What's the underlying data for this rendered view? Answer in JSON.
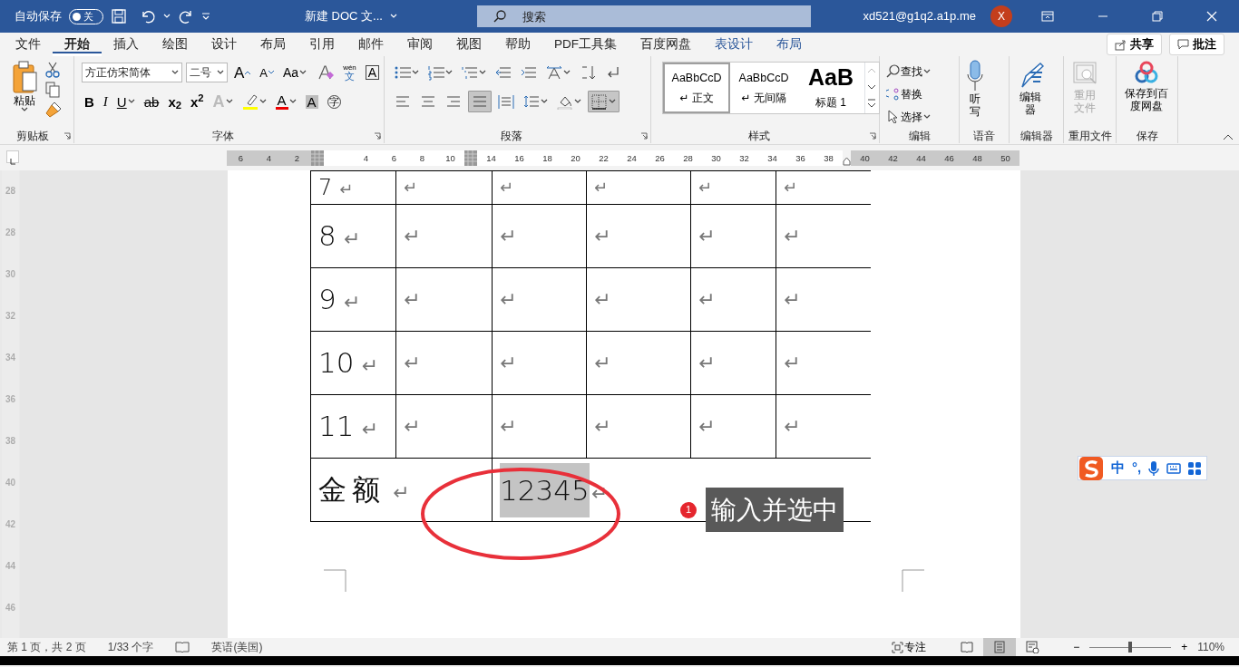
{
  "title_bar": {
    "autosave_label": "自动保存",
    "autosave": {
      "on": false,
      "label": "关"
    },
    "document_title": "新建 DOC 文...",
    "search": {
      "placeholder": "搜索"
    },
    "account": "xd521@g1q2.a1p.me",
    "avatar_initial": "X"
  },
  "ribbon_tabs": [
    {
      "label": "文件",
      "selected": false,
      "kind": "normal"
    },
    {
      "label": "开始",
      "selected": true,
      "kind": "normal"
    },
    {
      "label": "插入",
      "selected": false,
      "kind": "normal"
    },
    {
      "label": "绘图",
      "selected": false,
      "kind": "normal"
    },
    {
      "label": "设计",
      "selected": false,
      "kind": "normal"
    },
    {
      "label": "布局",
      "selected": false,
      "kind": "normal"
    },
    {
      "label": "引用",
      "selected": false,
      "kind": "normal"
    },
    {
      "label": "邮件",
      "selected": false,
      "kind": "normal"
    },
    {
      "label": "审阅",
      "selected": false,
      "kind": "normal"
    },
    {
      "label": "视图",
      "selected": false,
      "kind": "normal"
    },
    {
      "label": "帮助",
      "selected": false,
      "kind": "normal"
    },
    {
      "label": "PDF工具集",
      "selected": false,
      "kind": "normal"
    },
    {
      "label": "百度网盘",
      "selected": false,
      "kind": "normal"
    },
    {
      "label": "表设计",
      "selected": false,
      "kind": "contextual"
    },
    {
      "label": "布局",
      "selected": false,
      "kind": "contextual"
    }
  ],
  "share_button": "共享",
  "comments_button": "批注",
  "ribbon": {
    "clipboard": {
      "paste": "粘贴",
      "label": "剪贴板"
    },
    "font": {
      "font_name": "方正仿宋简体",
      "font_size": "二号",
      "label": "字体",
      "row1": [
        {
          "kind": "grow",
          "text": "A"
        },
        {
          "kind": "shrink",
          "text": "A"
        },
        {
          "kind": "case",
          "text": "Aa"
        },
        {
          "kind": "clear"
        },
        {
          "kind": "phonetic",
          "text": "wén",
          "sub": "文"
        },
        {
          "kind": "border",
          "text": "A"
        }
      ],
      "row2": [
        {
          "kind": "bold",
          "text": "B"
        },
        {
          "kind": "italic",
          "text": "I"
        },
        {
          "kind": "underline",
          "text": "U"
        },
        {
          "kind": "strike",
          "text": "ab"
        },
        {
          "kind": "subscript",
          "text": "x$_{2}$"
        },
        {
          "kind": "superscript",
          "text": "x$^{2}$"
        },
        {
          "kind": "effects",
          "text": "A"
        },
        {
          "kind": "highlight"
        },
        {
          "kind": "color",
          "text": "A"
        },
        {
          "kind": "shading",
          "text": "A"
        },
        {
          "kind": "enclose",
          "text": "字"
        }
      ]
    },
    "paragraph": {
      "label": "段落",
      "row1": [
        {
          "kind": "bullets"
        },
        {
          "kind": "numbering"
        },
        {
          "kind": "multilevel"
        },
        {
          "kind": "outdent"
        },
        {
          "kind": "indent"
        },
        {
          "kind": "asian-layout"
        },
        {
          "kind": "sort"
        },
        {
          "kind": "marks"
        }
      ],
      "row2": [
        {
          "kind": "align-left",
          "selected": false
        },
        {
          "kind": "align-center",
          "selected": false
        },
        {
          "kind": "align-right",
          "selected": false
        },
        {
          "kind": "justify",
          "selected": true
        },
        {
          "kind": "distribute",
          "selected": false
        },
        {
          "kind": "line-spacing",
          "selected": false
        },
        {
          "kind": "fill",
          "selected": false
        },
        {
          "kind": "borders",
          "selected": true
        }
      ]
    },
    "styles": {
      "label": "样式",
      "items": [
        {
          "preview": "AaBbCcD",
          "name": "↵ 正文",
          "selected": true,
          "kind": "body"
        },
        {
          "preview": "AaBbCcD",
          "name": "↵ 无间隔",
          "selected": false,
          "kind": "body"
        },
        {
          "preview": "AaB",
          "name": "标题 1",
          "selected": false,
          "kind": "heading"
        }
      ]
    },
    "editing": {
      "label": "编辑",
      "find": "查找",
      "replace": "替换",
      "select": "选择"
    },
    "voice": {
      "label": "语音",
      "dictate": "听写"
    },
    "editor": {
      "label": "编辑器",
      "button": "编辑器"
    },
    "reuse": {
      "label": "重用文件",
      "button": "重用文件",
      "disabled": true
    },
    "save": {
      "label": "保存",
      "button": "保存到百度网盘"
    }
  },
  "ruler": {
    "segments": [
      {
        "shaded": true,
        "ticks": [
          "6",
          "4",
          "2"
        ]
      },
      {
        "shaded": false,
        "ticks": [
          "4",
          "6",
          "8",
          "10"
        ]
      },
      {
        "shaded": false,
        "ticks": [
          "14",
          "16",
          "18",
          "20",
          "22",
          "24",
          "26",
          "28",
          "30",
          "32",
          "34",
          "36",
          "38"
        ]
      },
      {
        "shaded": true,
        "ticks": [
          "40",
          "42",
          "44",
          "46",
          "48",
          "50"
        ]
      }
    ]
  },
  "vertical_ruler": [
    "28",
    "28",
    "30",
    "32",
    "34",
    "36",
    "38",
    "40",
    "42",
    "44",
    "46"
  ],
  "table": {
    "rows": [
      {
        "cells": [
          {
            "text": "7",
            "mark": "↵"
          },
          {
            "mark": "↵"
          },
          {
            "mark": "↵"
          },
          {
            "mark": "↵"
          },
          {
            "mark": "↵"
          },
          {
            "mark": "↵"
          }
        ]
      },
      {
        "cells": [
          {
            "text": "8",
            "mark": "↵"
          },
          {
            "mark": "↵"
          },
          {
            "mark": "↵"
          },
          {
            "mark": "↵"
          },
          {
            "mark": "↵"
          },
          {
            "mark": "↵"
          }
        ]
      },
      {
        "cells": [
          {
            "text": "9",
            "mark": "↵"
          },
          {
            "mark": "↵"
          },
          {
            "mark": "↵"
          },
          {
            "mark": "↵"
          },
          {
            "mark": "↵"
          },
          {
            "mark": "↵"
          }
        ]
      },
      {
        "cells": [
          {
            "text": "10",
            "mark": "↵"
          },
          {
            "mark": "↵"
          },
          {
            "mark": "↵"
          },
          {
            "mark": "↵"
          },
          {
            "mark": "↵"
          },
          {
            "mark": "↵"
          }
        ]
      },
      {
        "cells": [
          {
            "text": "11",
            "mark": "↵"
          },
          {
            "mark": "↵"
          },
          {
            "mark": "↵"
          },
          {
            "mark": "↵"
          },
          {
            "mark": "↵"
          },
          {
            "mark": "↵"
          }
        ]
      }
    ],
    "total_row": {
      "label": {
        "text": "金额",
        "mark": "↵"
      },
      "value": {
        "text": "12345",
        "mark": "↵",
        "selected": true
      }
    }
  },
  "annotation": {
    "step": "1",
    "text": "输入并选中"
  },
  "ime_toolbar": {
    "mode": "中",
    "punctuation": "°,"
  },
  "status_bar": {
    "page": "第 1 页，共 2 页",
    "words": "1/33 个字",
    "language": "英语(美国)",
    "focus": "专注",
    "views": [
      {
        "kind": "read",
        "selected": false
      },
      {
        "kind": "print",
        "selected": true
      },
      {
        "kind": "web",
        "selected": false
      }
    ],
    "zoom_out": "−",
    "zoom_in": "+",
    "zoom": {
      "level": 0.5
    },
    "zoom_value": "110%"
  }
}
